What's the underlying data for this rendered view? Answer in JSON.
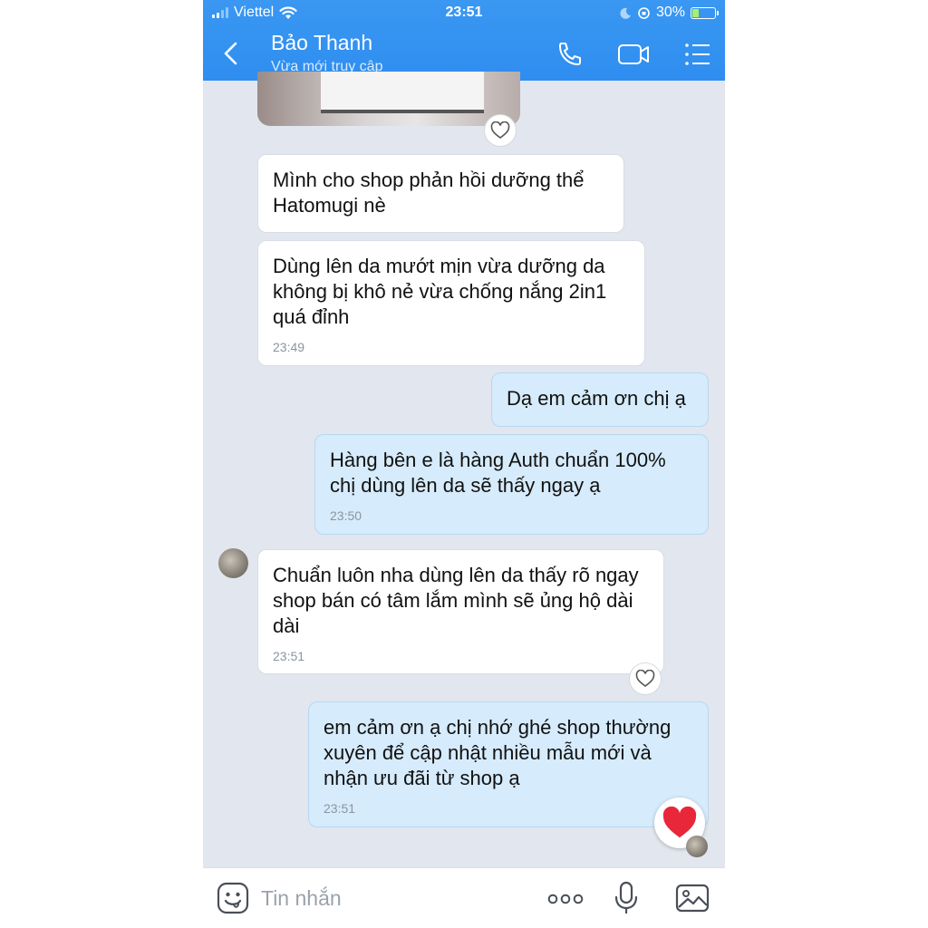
{
  "status_bar": {
    "carrier": "Viettel",
    "time": "23:51",
    "battery": "30%",
    "battery_level": 0.3
  },
  "header": {
    "contact_name": "Bảo Thanh",
    "contact_status": "Vừa mới truy cập",
    "icons": [
      "back-icon",
      "phone-icon",
      "video-icon",
      "menu-list-icon"
    ]
  },
  "messages": [
    {
      "direction": "in",
      "text": "Mình cho shop phản hồi dưỡng thể Hatomugi nè",
      "time": ""
    },
    {
      "direction": "in",
      "text": "Dùng lên da mướt mịn vừa dưỡng da không bị khô nẻ vừa chống nắng 2in1 quá đỉnh",
      "time": "23:49"
    },
    {
      "direction": "out",
      "text": "Dạ em cảm ơn chị ạ",
      "time": ""
    },
    {
      "direction": "out",
      "text": "Hàng bên e là hàng Auth chuẩn 100% chị dùng lên da sẽ thấy ngay ạ",
      "time": "23:50"
    },
    {
      "direction": "in",
      "text": "Chuẩn luôn nha dùng lên da thấy rõ ngay shop bán có tâm lắm mình sẽ ủng hộ dài dài",
      "time": "23:51"
    },
    {
      "direction": "out",
      "text": "em cảm ơn ạ chị nhớ ghé shop thường xuyên để cập nhật nhiều mẫu mới và nhận ưu đãi từ shop ạ",
      "time": "23:51"
    }
  ],
  "reactions": {
    "heart_color": "#e8283a"
  },
  "input_bar": {
    "placeholder": "Tin nhắn",
    "icons": [
      "sticker-icon",
      "more-icon",
      "microphone-icon",
      "gallery-icon"
    ]
  },
  "colors": {
    "header": "#2f8df0",
    "chat_background": "#e2e6ee",
    "outgoing_bubble": "#d6ebfb",
    "incoming_bubble": "#ffffff"
  }
}
